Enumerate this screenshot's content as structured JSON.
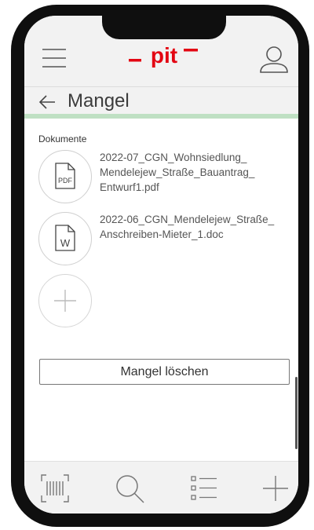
{
  "header": {
    "logo_text": "pit",
    "brand_color": "#e30613"
  },
  "page": {
    "title": "Mangel"
  },
  "documents": {
    "section_label": "Dokumente",
    "items": [
      {
        "type": "PDF",
        "name": "2022-07_CGN_Wohnsiedlung_ Mendelejew_Straße_Bauantrag_ Entwurf1.pdf"
      },
      {
        "type": "W",
        "name": "2022-06_CGN_Mendelejew_Straße_ Anschreiben-Mieter_1.doc"
      }
    ]
  },
  "actions": {
    "delete_label": "Mangel löschen"
  },
  "bottom_nav": {
    "items": [
      "barcode-icon",
      "search-icon",
      "list-icon",
      "plus-icon"
    ]
  }
}
